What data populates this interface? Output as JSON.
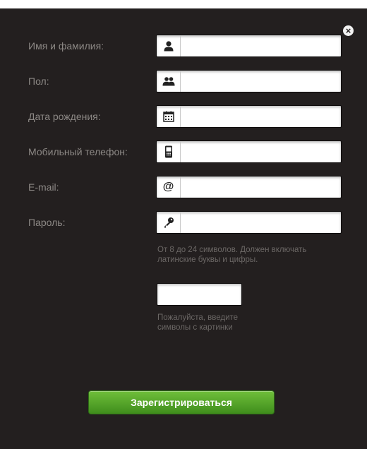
{
  "form": {
    "fields": [
      {
        "label": "Имя и фамилия:",
        "icon": "person-icon",
        "value": ""
      },
      {
        "label": "Пол:",
        "icon": "people-icon",
        "value": ""
      },
      {
        "label": "Дата рождения:",
        "icon": "calendar-icon",
        "value": ""
      },
      {
        "label": "Мобильный телефон:",
        "icon": "mobile-phone-icon",
        "value": ""
      },
      {
        "label": "E-mail:",
        "icon": "at-sign-icon",
        "value": ""
      },
      {
        "label": "Пароль:",
        "icon": "key-icon",
        "value": ""
      }
    ],
    "password_hint_line1": "От 8 до 24 символов. Должен включать",
    "password_hint_line2": "латинские буквы и цифры.",
    "captcha_value": "",
    "captcha_hint_line1": "Пожалуйста, введите",
    "captcha_hint_line2": "символы с картинки",
    "register_label": "Зарегистрироваться",
    "close_symbol": "×"
  }
}
